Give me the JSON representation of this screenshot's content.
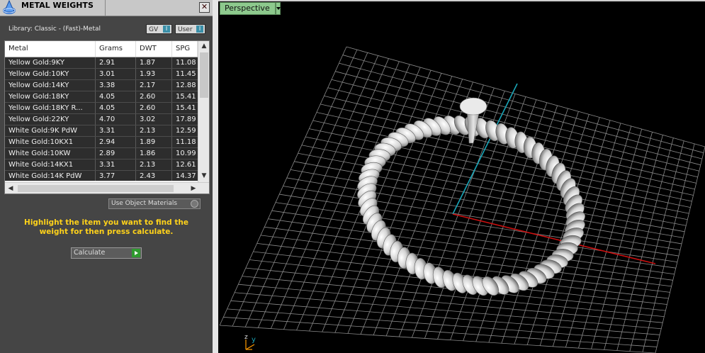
{
  "panel": {
    "title": "METAL WEIGHTS",
    "close_label": "✕",
    "library_label": "Library: Classic - (Fast)-Metal",
    "gv_label": "GV",
    "user_label": "User",
    "toggle_symbol": "I",
    "use_object_materials_label": "Use Object Materials",
    "hint": "Highlight the item you want to find the weight for then press calculate.",
    "calculate_label": "Calculate"
  },
  "table": {
    "columns": [
      "Metal",
      "Grams",
      "DWT",
      "SPG"
    ],
    "rows": [
      [
        "Yellow Gold:9KY",
        "2.91",
        "1.87",
        "11.08"
      ],
      [
        "Yellow Gold:10KY",
        "3.01",
        "1.93",
        "11.45"
      ],
      [
        "Yellow Gold:14KY",
        "3.38",
        "2.17",
        "12.88"
      ],
      [
        "Yellow Gold:18KY",
        "4.05",
        "2.60",
        "15.41"
      ],
      [
        "Yellow Gold:18KY R...",
        "4.05",
        "2.60",
        "15.41"
      ],
      [
        "Yellow Gold:22KY",
        "4.70",
        "3.02",
        "17.89"
      ],
      [
        "White Gold:9K PdW",
        "3.31",
        "2.13",
        "12.59"
      ],
      [
        "White Gold:10KX1",
        "2.94",
        "1.89",
        "11.18"
      ],
      [
        "White Gold:10KW",
        "2.89",
        "1.86",
        "10.99"
      ],
      [
        "White Gold:14KX1",
        "3.31",
        "2.13",
        "12.61"
      ],
      [
        "White Gold:14K PdW",
        "3.77",
        "2.43",
        "14.37"
      ]
    ]
  },
  "viewport": {
    "view_label": "Perspective",
    "axis_z": "z",
    "axis_y": "y",
    "colors": {
      "x_axis": "#cc1010",
      "y_axis": "#1aa6b8",
      "grid": "#8a8a8a"
    }
  },
  "icons": [
    "app-logo-icon",
    "close-icon",
    "scroll-up-icon",
    "scroll-down-icon",
    "scroll-left-icon",
    "scroll-right-icon",
    "play-icon",
    "dropdown-arrow-icon"
  ]
}
